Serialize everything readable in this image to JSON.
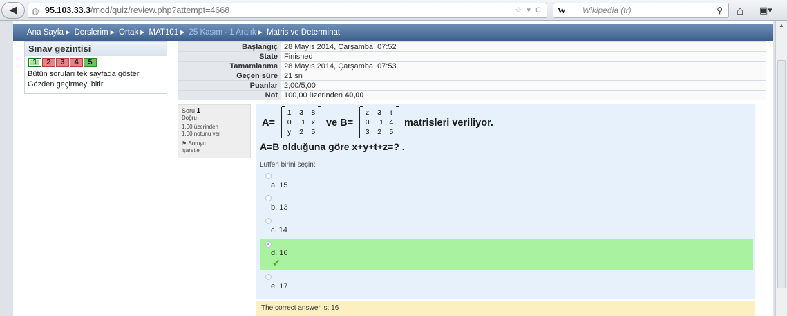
{
  "browser": {
    "url_host": "95.103.33.3",
    "url_path": "/mod/quiz/review.php?attempt=4668",
    "url_controls": "☆ ▾ C",
    "search_engine": "W",
    "search_placeholder": "Wikipedia (tr)"
  },
  "breadcrumb": {
    "items": [
      "Ana Sayfa",
      "Derslerim",
      "Ortak",
      "MAT101"
    ],
    "muted_item": "25 Kasım - 1 Aralık",
    "current": "Matris ve Determinat"
  },
  "nav": {
    "title": "Sınav gezintisi",
    "questions": [
      {
        "label": "1",
        "state": "correct"
      },
      {
        "label": "2",
        "state": "incorrect"
      },
      {
        "label": "3",
        "state": "incorrect"
      },
      {
        "label": "4",
        "state": "incorrect"
      },
      {
        "label": "5",
        "state": "correct"
      }
    ],
    "show_all": "Bütün soruları tek sayfada göster",
    "finish_review": "Gözden geçirmeyi bitir"
  },
  "summary": {
    "rows": [
      {
        "label": "Başlangıç",
        "value": "28 Mayıs 2014, Çarşamba, 07:52"
      },
      {
        "label": "State",
        "value": "Finished"
      },
      {
        "label": "Tamamlanma",
        "value": "28 Mayıs 2014, Çarşamba, 07:53"
      },
      {
        "label": "Geçen süre",
        "value": "21 sn"
      },
      {
        "label": "Puanlar",
        "value": "2,00/5,00"
      }
    ],
    "grade_label": "Not",
    "grade_prefix": "100,00 üzerinden ",
    "grade_value": "40,00"
  },
  "question_info": {
    "soru_label": "Soru",
    "number": "1",
    "status": "Doğru",
    "mark_line1": "1,00 üzerinden",
    "mark_line2": "1,00 notunu ver",
    "flag_line1": "Soruyu",
    "flag_line2": "işaretle"
  },
  "question": {
    "a_label": "A=",
    "matrix_a": [
      "1",
      "3",
      "8",
      "0",
      "−1",
      "x",
      "y",
      "2",
      "5"
    ],
    "ve_b_label": "ve B=",
    "matrix_b": [
      "z",
      "3",
      "t",
      "0",
      "−1",
      "4",
      "3",
      "2",
      "5"
    ],
    "suffix": "matrisleri veriliyor.",
    "subtext": "A=B olduğuna göre x+y+t+z=? .",
    "prompt": "Lütfen birini seçin:",
    "answers": [
      {
        "label": "a. 15",
        "selected": false
      },
      {
        "label": "b. 13",
        "selected": false
      },
      {
        "label": "c. 14",
        "selected": false
      },
      {
        "label": "d. 16",
        "selected": true
      },
      {
        "label": "e. 17",
        "selected": false
      }
    ]
  },
  "feedback": "The correct answer is: 16",
  "colors": {
    "correct_bg": "#a8f2a0",
    "question_bg": "#e7f1fb",
    "feedback_bg": "#fcefc0",
    "breadcrumb_bar": "#3e5f8b"
  }
}
